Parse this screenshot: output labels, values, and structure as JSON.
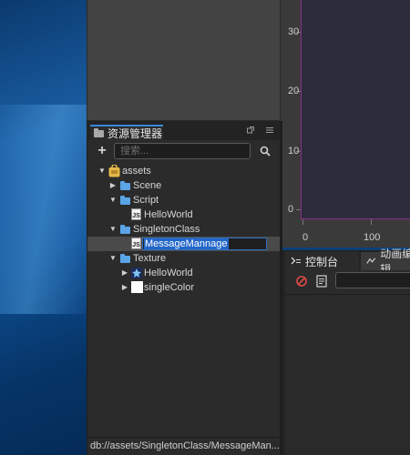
{
  "assets_panel": {
    "tab_label": "资源管理器",
    "search_placeholder": "搜索...",
    "status_path": "db://assets/SingletonClass/MessageMan..."
  },
  "tree": {
    "root": "assets",
    "scene": "Scene",
    "script": "Script",
    "helloworld_script": "HelloWorld",
    "singleton": "SingletonClass",
    "message_edit": "MessageMannage",
    "texture": "Texture",
    "helloworld_img": "HelloWorld",
    "singlecolor": "singleColor",
    "js_badge": "JS"
  },
  "scene": {
    "y_ticks": [
      "30",
      "20",
      "10",
      "0"
    ],
    "x_ticks": [
      "0",
      "100"
    ]
  },
  "console": {
    "tab_console": "控制台",
    "tab_animation": "动画编辑"
  },
  "colors": {
    "accent": "#3a87dd",
    "selection": "#2366c8",
    "scene_border": "#8a2a8a"
  },
  "icons": [
    "folder-icon",
    "settings-icon",
    "menu-icon",
    "plus-icon",
    "search-icon",
    "clear-icon",
    "log-icon",
    "console-icon",
    "animation-icon"
  ]
}
